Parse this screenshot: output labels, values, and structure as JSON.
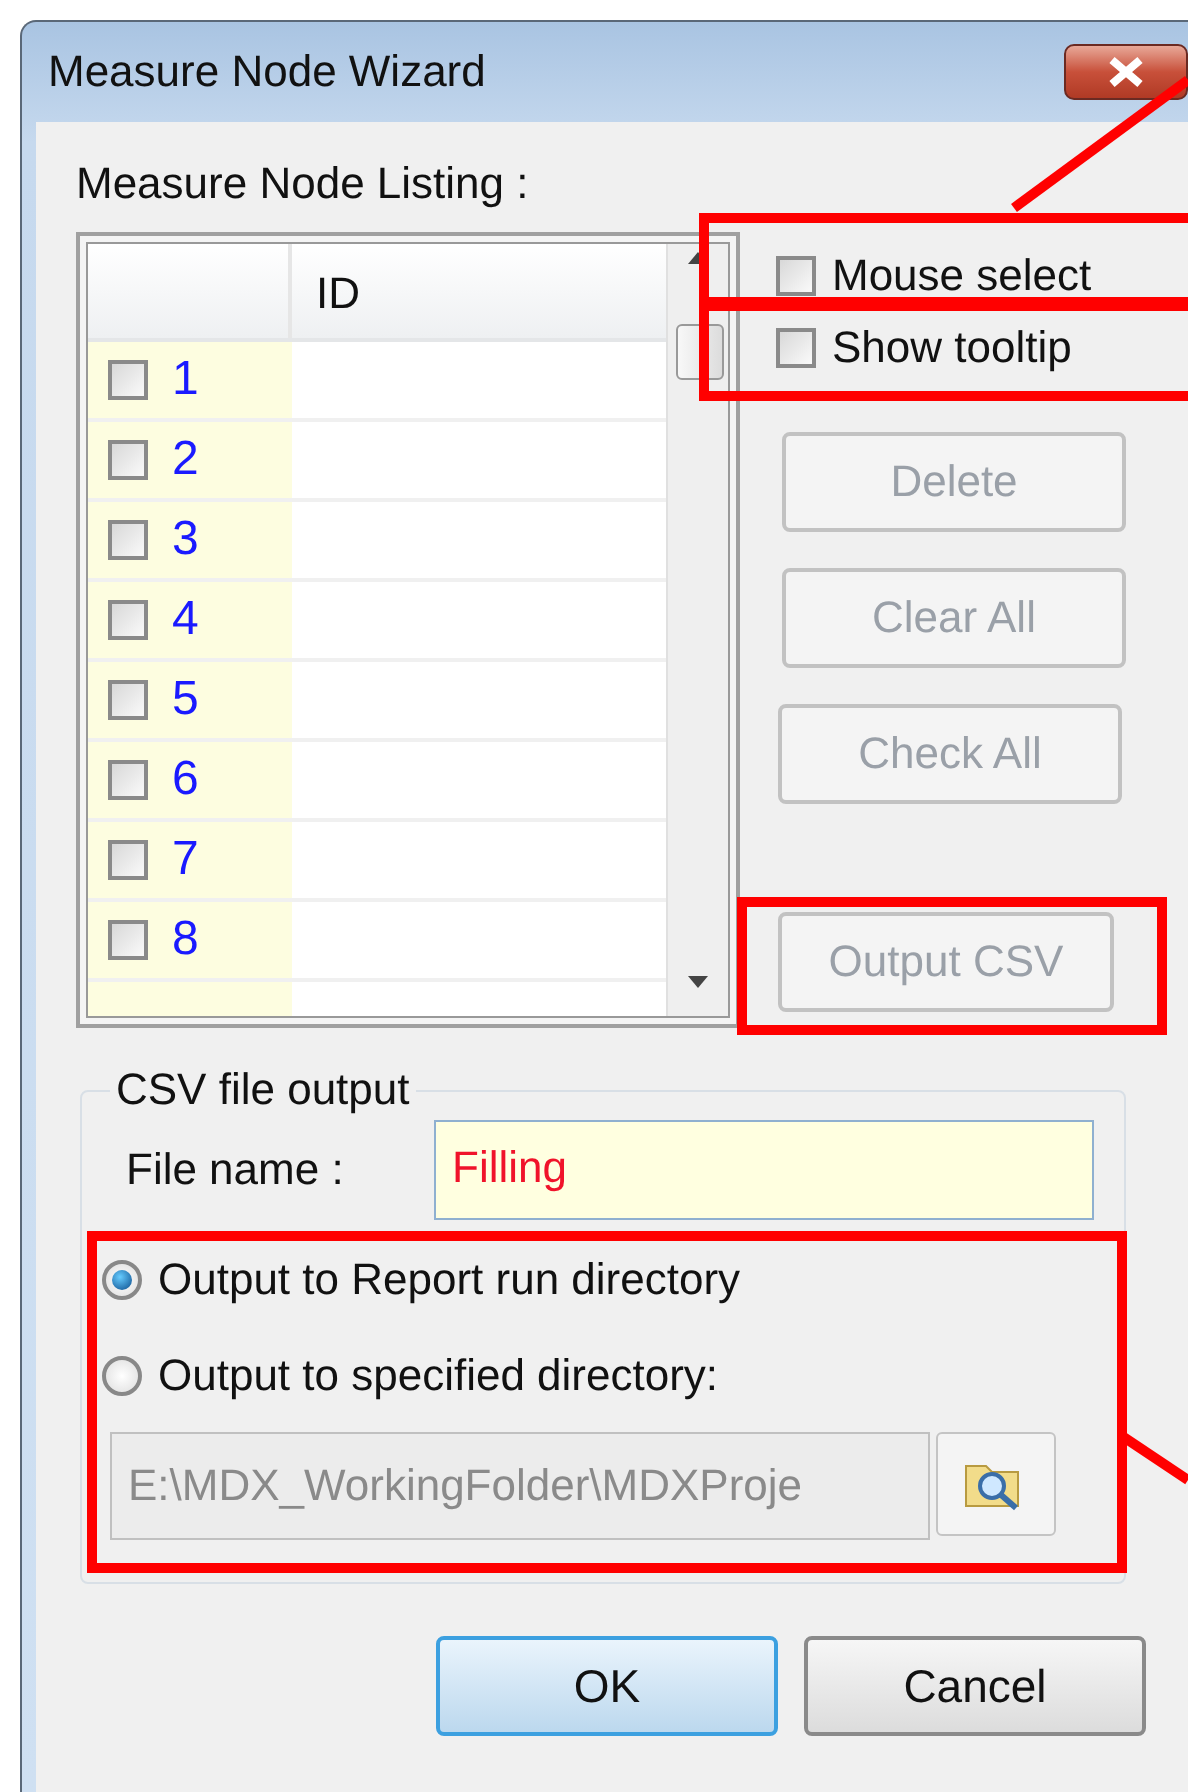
{
  "window": {
    "title": "Measure Node Wizard"
  },
  "listing": {
    "label": "Measure Node Listing :",
    "columns": [
      "ID"
    ],
    "rows": [
      {
        "number": "1",
        "checked": false
      },
      {
        "number": "2",
        "checked": false
      },
      {
        "number": "3",
        "checked": false
      },
      {
        "number": "4",
        "checked": false
      },
      {
        "number": "5",
        "checked": false
      },
      {
        "number": "6",
        "checked": false
      },
      {
        "number": "7",
        "checked": false
      },
      {
        "number": "8",
        "checked": false
      }
    ]
  },
  "options": [
    {
      "label": "Mouse select",
      "checked": false
    },
    {
      "label": "Show tooltip",
      "checked": false
    }
  ],
  "actions": [
    {
      "label": "Delete",
      "disabled": true
    },
    {
      "label": "Clear All",
      "disabled": true
    },
    {
      "label": "Check All",
      "disabled": true
    }
  ],
  "output_button": {
    "label": "Output CSV",
    "disabled": true
  },
  "csv_output": {
    "title": "CSV file output",
    "file_name_label": "File name :",
    "file_name": "Filling",
    "destinations": [
      {
        "label": "Output to Report run directory",
        "selected": true
      },
      {
        "label": "Output to specified directory:",
        "selected": false
      }
    ],
    "directory": "E:\\MDX_WorkingFolder\\MDXProje",
    "directory_disabled": true
  },
  "buttons": [
    {
      "label": "OK",
      "default": true
    },
    {
      "label": "Cancel",
      "default": false
    }
  ]
}
